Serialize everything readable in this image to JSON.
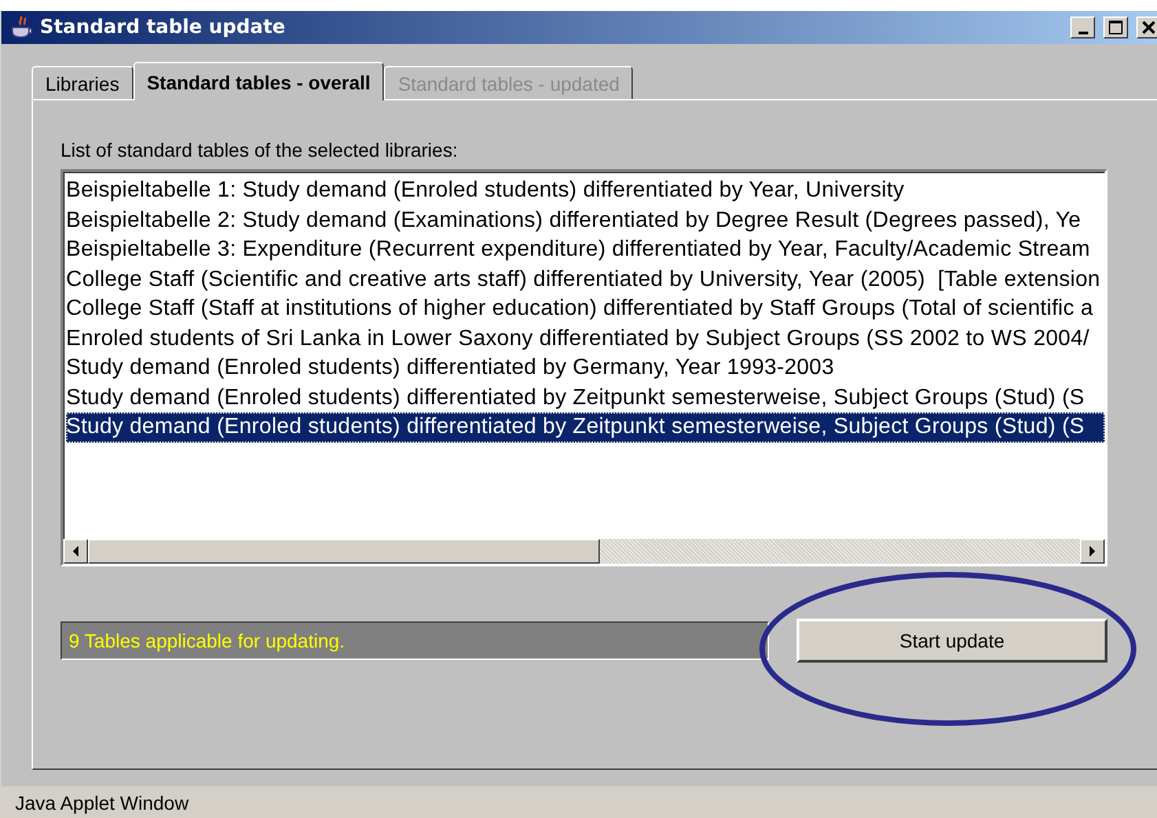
{
  "window": {
    "title": "Standard table update"
  },
  "tabs": [
    {
      "label": "Libraries",
      "selected": false,
      "disabled": false
    },
    {
      "label": "Standard tables - overall",
      "selected": true,
      "disabled": false
    },
    {
      "label": "Standard tables - updated",
      "selected": false,
      "disabled": true
    }
  ],
  "list": {
    "label": "List of standard tables of the selected libraries:",
    "items": [
      {
        "text": "Beispieltabelle 1: Study demand (Enroled students) differentiated by Year, University",
        "selected": false
      },
      {
        "text": "Beispieltabelle 2: Study demand (Examinations) differentiated by Degree Result (Degrees passed), Ye",
        "selected": false
      },
      {
        "text": "Beispieltabelle 3: Expenditure (Recurrent expenditure) differentiated by Year, Faculty/Academic Stream",
        "selected": false
      },
      {
        "text": "College Staff (Scientific and creative arts staff) differentiated by University, Year (2005)  [Table extension",
        "selected": false
      },
      {
        "text": "College Staff (Staff at institutions of higher education) differentiated by Staff Groups (Total of scientific a",
        "selected": false
      },
      {
        "text": "Enroled students of Sri Lanka in Lower Saxony differentiated by Subject Groups (SS 2002 to WS 2004/",
        "selected": false
      },
      {
        "text": "Study demand (Enroled students) differentiated by Germany, Year 1993-2003",
        "selected": false
      },
      {
        "text": "Study demand (Enroled students) differentiated by Zeitpunkt semesterweise, Subject Groups (Stud) (S",
        "selected": false
      },
      {
        "text": "Study demand (Enroled students) differentiated by Zeitpunkt semesterweise, Subject Groups (Stud) (S",
        "selected": true
      }
    ]
  },
  "status_message": "9 Tables applicable for updating.",
  "start_button": {
    "label": "Start update"
  },
  "status_bar": "Java Applet Window"
}
